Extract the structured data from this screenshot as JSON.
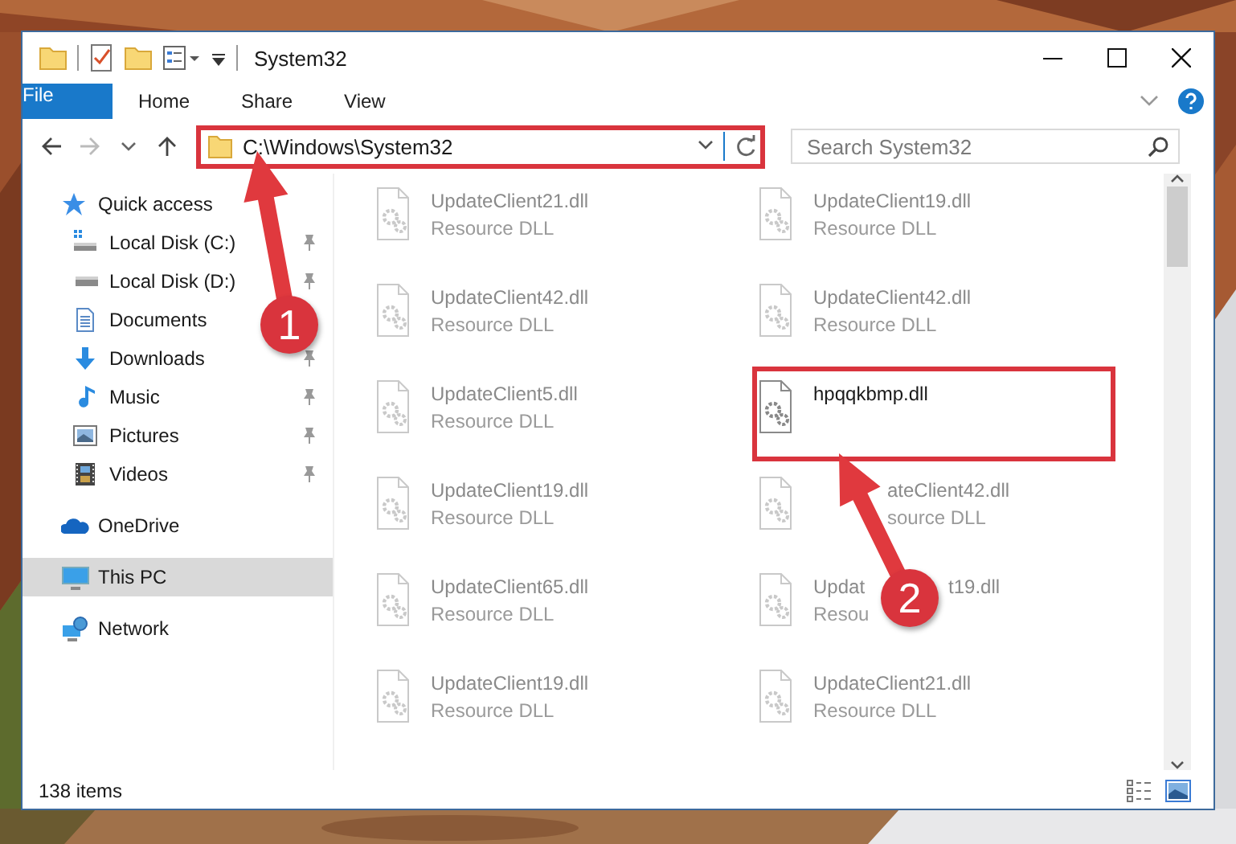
{
  "window": {
    "title": "System32"
  },
  "ribbon_tabs": [
    {
      "label": "File",
      "kind": "file"
    },
    {
      "label": "Home",
      "kind": "tab"
    },
    {
      "label": "Share",
      "kind": "tab"
    },
    {
      "label": "View",
      "kind": "tab"
    }
  ],
  "address_bar": {
    "path": "C:\\Windows\\System32",
    "highlighted": true
  },
  "search": {
    "placeholder": "Search System32"
  },
  "navigation": [
    {
      "label": "Quick access",
      "kind": "star",
      "selected": false,
      "children": [
        {
          "label": "Local Disk (C:)",
          "kind": "system-drive",
          "pinned": true,
          "selected": false
        },
        {
          "label": "Local Disk (D:)",
          "kind": "drive",
          "pinned": true,
          "selected": false
        },
        {
          "label": "Documents",
          "kind": "documents",
          "selected": false
        },
        {
          "label": "Downloads",
          "kind": "downloads",
          "pinned": true,
          "selected": false
        },
        {
          "label": "Music",
          "kind": "music",
          "pinned": true,
          "selected": false
        },
        {
          "label": "Pictures",
          "kind": "pictures",
          "pinned": true,
          "selected": false
        },
        {
          "label": "Videos",
          "kind": "videos",
          "pinned": true,
          "selected": false
        }
      ]
    },
    {
      "label": "OneDrive",
      "kind": "cloud",
      "selected": false
    },
    {
      "label": "This PC",
      "kind": "pc",
      "selected": true
    },
    {
      "label": "Network",
      "kind": "network",
      "selected": false
    }
  ],
  "files": [
    {
      "name": "UpdateClient21.dll",
      "type": "Resource DLL",
      "kind": "blurred",
      "highlighted": false
    },
    {
      "name": "UpdateClient19.dll",
      "type": "Resource DLL",
      "kind": "blurred",
      "highlighted": false
    },
    {
      "name": "UpdateClient42.dll",
      "type": "Resource DLL",
      "kind": "blurred",
      "highlighted": false
    },
    {
      "name": "UpdateClient42.dll",
      "type": "Resource DLL",
      "kind": "blurred",
      "highlighted": false
    },
    {
      "name": "UpdateClient5.dll",
      "type": "Resource DLL",
      "kind": "blurred",
      "highlighted": false
    },
    {
      "name": "hpqqkbmp.dll",
      "kind": "clear",
      "highlighted": true
    },
    {
      "name": "UpdateClient19.dll",
      "type": "Resource DLL",
      "kind": "blurred",
      "highlighted": false
    },
    {
      "name": "ateClient42.dll",
      "type": "source DLL",
      "kind": "blurred",
      "covered_start": true,
      "highlighted": false
    },
    {
      "name": "UpdateClient65.dll",
      "type": "Resource DLL",
      "kind": "blurred",
      "highlighted": false
    },
    {
      "name": "Updat",
      "name_tail": "t19.dll",
      "type": "Resou",
      "kind": "blurred",
      "highlighted": false
    },
    {
      "name": "UpdateClient19.dll",
      "type": "Resource DLL",
      "kind": "blurred",
      "highlighted": false
    },
    {
      "name": "UpdateClient21.dll",
      "type": "Resource DLL",
      "kind": "blurred",
      "highlighted": false
    }
  ],
  "status_bar": {
    "item_count": "138 items"
  },
  "callouts": [
    {
      "number": "1"
    },
    {
      "number": "2"
    }
  ]
}
